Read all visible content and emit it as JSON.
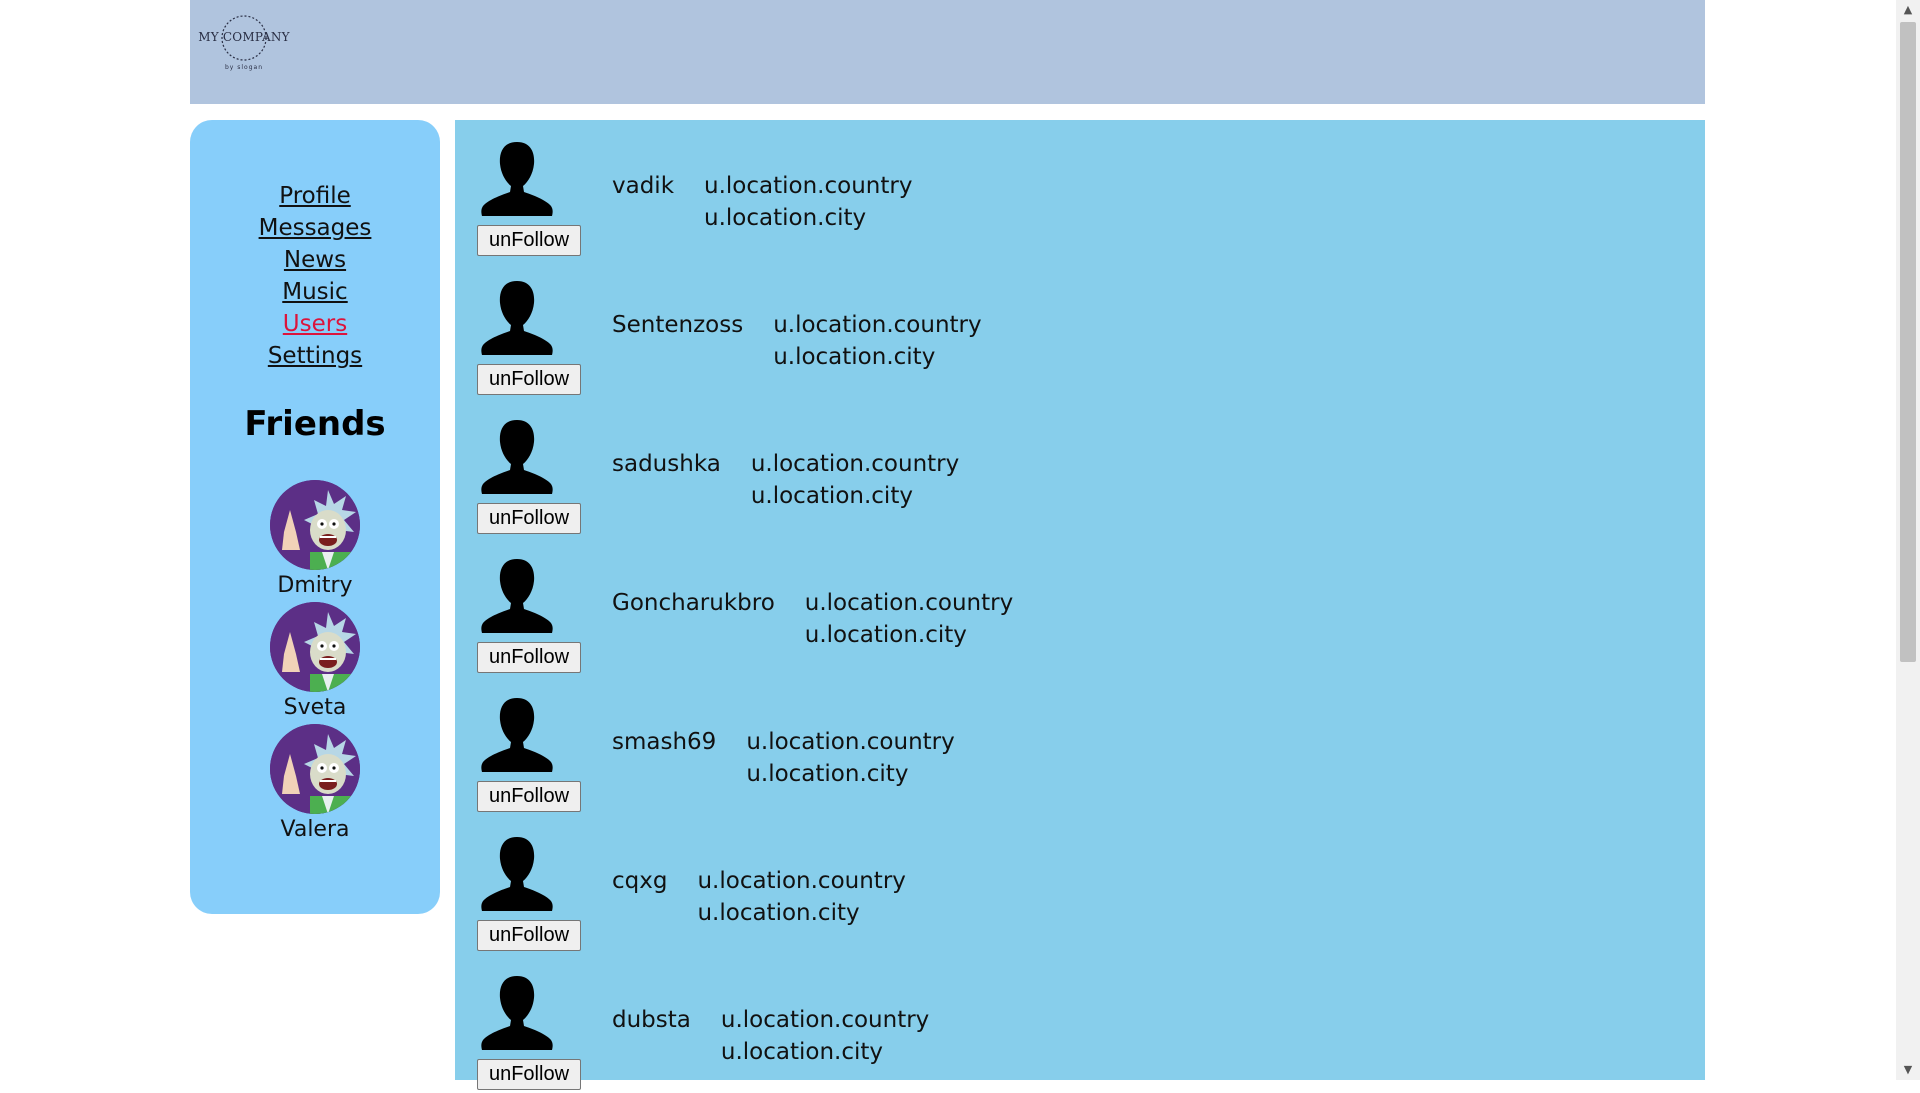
{
  "header": {
    "logo_text": "MY COMPANY",
    "logo_subtext": "by slogan"
  },
  "sidebar": {
    "nav": [
      {
        "label": "Profile",
        "active": false
      },
      {
        "label": "Messages",
        "active": false
      },
      {
        "label": "News",
        "active": false
      },
      {
        "label": "Music",
        "active": false
      },
      {
        "label": "Users",
        "active": true
      },
      {
        "label": "Settings",
        "active": false
      }
    ],
    "friends_title": "Friends",
    "friends": [
      {
        "name": "Dmitry"
      },
      {
        "name": "Sveta"
      },
      {
        "name": "Valera"
      }
    ]
  },
  "users": [
    {
      "name": "vadik",
      "country": "u.location.country",
      "city": "u.location.city",
      "button": "unFollow"
    },
    {
      "name": "Sentenzoss",
      "country": "u.location.country",
      "city": "u.location.city",
      "button": "unFollow"
    },
    {
      "name": "sadushka",
      "country": "u.location.country",
      "city": "u.location.city",
      "button": "unFollow"
    },
    {
      "name": "Goncharukbro",
      "country": "u.location.country",
      "city": "u.location.city",
      "button": "unFollow"
    },
    {
      "name": "smash69",
      "country": "u.location.country",
      "city": "u.location.city",
      "button": "unFollow"
    },
    {
      "name": "cqxg",
      "country": "u.location.country",
      "city": "u.location.city",
      "button": "unFollow"
    },
    {
      "name": "dubsta",
      "country": "u.location.country",
      "city": "u.location.city",
      "button": "unFollow"
    }
  ],
  "colors": {
    "header_bg": "#b0c4de",
    "sidebar_bg": "#87cefa",
    "content_bg": "#87ceeb",
    "active_link": "#dc143c"
  },
  "icons": {
    "user_photo": "person-silhouette-icon",
    "friend_avatar": "cartoon-avatar-icon"
  }
}
